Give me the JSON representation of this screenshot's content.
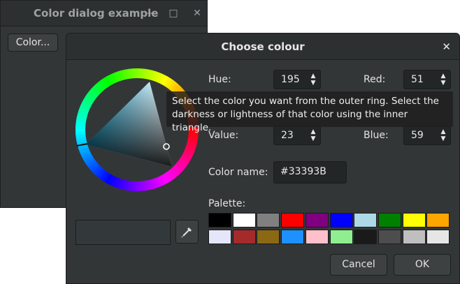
{
  "parent_window": {
    "title": "Color dialog example",
    "min_glyph": "—",
    "max_glyph": "□",
    "close_glyph": "✕",
    "color_button_label": "Color..."
  },
  "dialog": {
    "title": "Choose colour",
    "close_glyph": "✕",
    "fields": {
      "hue": {
        "label": "Hue:",
        "value": "195"
      },
      "red": {
        "label": "Red:",
        "value": "51"
      },
      "value": {
        "label": "Value:",
        "value": "23"
      },
      "blue": {
        "label": "Blue:",
        "value": "59"
      }
    },
    "color_name_label": "Color name:",
    "color_name_value": "#33393B",
    "palette_label": "Palette:",
    "palette": [
      "#000000",
      "#ffffff",
      "#808080",
      "#ff0000",
      "#800080",
      "#0000ff",
      "#add8e6",
      "#008000",
      "#ffff00",
      "#ffa500",
      "#e6e6fa",
      "#a52a2a",
      "#8b6914",
      "#1e90ff",
      "#ffc0cb",
      "#90ee90",
      "#1a1a1a",
      "#4d4d4d",
      "#bfbfbf",
      "#e6e6e6"
    ],
    "preview_color": "#33393B",
    "cancel_label": "Cancel",
    "ok_label": "OK",
    "tooltip": "Select the color you want from the outer ring. Select the darkness or lightness of that color using the inner triangle."
  }
}
